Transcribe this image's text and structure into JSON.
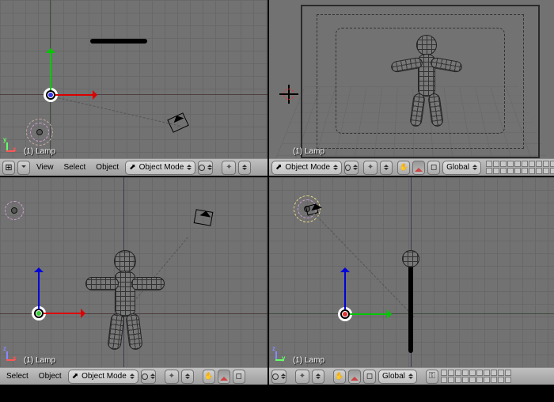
{
  "viewports": {
    "top": {
      "selection": "(1) Lamp",
      "axes": [
        "y",
        "x"
      ]
    },
    "camera": {
      "selection": "(1) Lamp"
    },
    "front": {
      "selection": "(1) Lamp",
      "axes": [
        "z",
        "x"
      ]
    },
    "side": {
      "selection": "(1) Lamp",
      "axes": [
        "z",
        "y"
      ]
    }
  },
  "toolbar": {
    "menu_view": "View",
    "menu_select": "Select",
    "menu_object": "Object",
    "mode_label": "Object Mode",
    "orientation_label": "Global"
  }
}
